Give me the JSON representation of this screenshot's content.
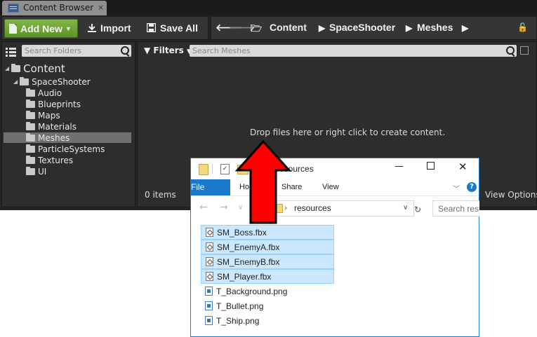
{
  "ue": {
    "tab_title": "Content Browser",
    "tab_close": "×",
    "toolbar": {
      "add_new_label": "Add New",
      "import_label": "Import",
      "save_all_label": "Save All"
    },
    "breadcrumb": [
      "Content",
      "SpaceShooter",
      "Meshes"
    ],
    "folders_search_placeholder": "Search Folders",
    "tree": {
      "root": "Content",
      "project": "SpaceShooter",
      "folders": [
        "Audio",
        "Blueprints",
        "Maps",
        "Materials",
        "Meshes",
        "ParticleSystems",
        "Textures",
        "UI"
      ],
      "selected": "Meshes"
    },
    "filters_label": "Filters",
    "assets_search_placeholder": "Search Meshes",
    "drop_hint": "Drop files here or right click to create content.",
    "items_count": "0 items",
    "view_options": "View Options"
  },
  "explorer": {
    "title": "resources",
    "ribbon_tabs": [
      "File",
      "Home",
      "Share",
      "View"
    ],
    "address": "resources",
    "search_placeholder": "Search res...",
    "files": [
      {
        "name": "SM_Boss.fbx",
        "type": "fbx",
        "selected": true
      },
      {
        "name": "SM_EnemyA.fbx",
        "type": "fbx",
        "selected": true
      },
      {
        "name": "SM_EnemyB.fbx",
        "type": "fbx",
        "selected": true
      },
      {
        "name": "SM_Player.fbx",
        "type": "fbx",
        "selected": true
      },
      {
        "name": "T_Background.png",
        "type": "png",
        "selected": false
      },
      {
        "name": "T_Bullet.png",
        "type": "png",
        "selected": false
      },
      {
        "name": "T_Ship.png",
        "type": "png",
        "selected": false
      }
    ]
  },
  "colors": {
    "ue_background": "#242424",
    "add_new_green": "#6ea638",
    "selection_row": "#707070",
    "explorer_accent": "#1979ca",
    "file_selection": "#cce8ff",
    "arrow_red": "#ff0000"
  }
}
